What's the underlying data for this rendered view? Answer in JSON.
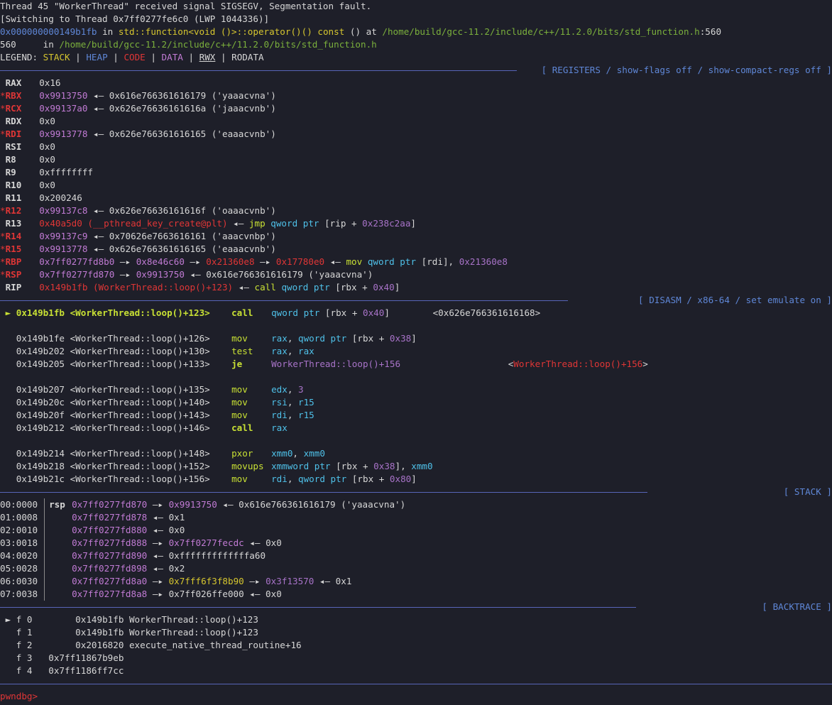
{
  "header": {
    "signal_line": "Thread 45 \"WorkerThread\" received signal SIGSEGV, Segmentation fault.",
    "switch_line": "[Switching to Thread 0x7ff0277fe6c0 (LWP 1044336)]",
    "frame_addr": "0x000000000149b1fb",
    "frame_in": " in ",
    "frame_func": "std::function<void ()>::operator()() const",
    "frame_args": " () at ",
    "frame_path": "/home/build/gcc-11.2/include/c++/11.2.0/bits/std_function.h",
    "frame_line": ":560",
    "source_lineno": "560",
    "source_in": "     in ",
    "source_path": "/home/build/gcc-11.2/include/c++/11.2.0/bits/std_function.h",
    "legend_label": "LEGEND: ",
    "legend": {
      "stack": "STACK",
      "heap": "HEAP",
      "code": "CODE",
      "data": "DATA",
      "rwx": "RWX",
      "rodata": "RODATA",
      "sep": " | "
    }
  },
  "sections": {
    "registers": "[ REGISTERS / show-flags off / show-compact-regs off ]",
    "disasm": "[ DISASM / x86-64 / set emulate on ]",
    "stack": "[ STACK ]",
    "backtrace": "[ BACKTRACE ]"
  },
  "registers": [
    {
      "star": " ",
      "name": "RAX",
      "parts": [
        [
          "white",
          "0x16"
        ]
      ]
    },
    {
      "star": "*",
      "name": "RBX",
      "parts": [
        [
          "purple",
          "0x9913750"
        ],
        [
          "white",
          " ◂— 0x616e766361616179 ('yaaacvna')"
        ]
      ]
    },
    {
      "star": "*",
      "name": "RCX",
      "parts": [
        [
          "purple",
          "0x99137a0"
        ],
        [
          "white",
          " ◂— 0x626e76636161616a ('jaaacvnb')"
        ]
      ]
    },
    {
      "star": " ",
      "name": "RDX",
      "parts": [
        [
          "white",
          "0x0"
        ]
      ]
    },
    {
      "star": "*",
      "name": "RDI",
      "parts": [
        [
          "purple",
          "0x9913778"
        ],
        [
          "white",
          " ◂— 0x626e766361616165 ('eaaacvnb')"
        ]
      ]
    },
    {
      "star": " ",
      "name": "RSI",
      "parts": [
        [
          "white",
          "0x0"
        ]
      ]
    },
    {
      "star": " ",
      "name": "R8",
      "parts": [
        [
          "white",
          "0x0"
        ]
      ]
    },
    {
      "star": " ",
      "name": "R9",
      "parts": [
        [
          "white",
          "0xffffffff"
        ]
      ]
    },
    {
      "star": " ",
      "name": "R10",
      "parts": [
        [
          "white",
          "0x0"
        ]
      ]
    },
    {
      "star": " ",
      "name": "R11",
      "parts": [
        [
          "white",
          "0x200246"
        ]
      ]
    },
    {
      "star": "*",
      "name": "R12",
      "parts": [
        [
          "purple",
          "0x99137c8"
        ],
        [
          "white",
          " ◂— 0x626e76636161616f ('oaaacvnb')"
        ]
      ]
    },
    {
      "star": " ",
      "name": "R13",
      "parts": [
        [
          "red",
          "0x40a5d0 (__pthread_key_create@plt)"
        ],
        [
          "white",
          " ◂— "
        ],
        [
          "lime",
          "jmp"
        ],
        [
          "white",
          " "
        ],
        [
          "cyan",
          "qword ptr"
        ],
        [
          "white",
          " [rip + "
        ],
        [
          "mag",
          "0x238c2aa"
        ],
        [
          "white",
          "]"
        ]
      ]
    },
    {
      "star": "*",
      "name": "R14",
      "parts": [
        [
          "purple",
          "0x99137c9"
        ],
        [
          "white",
          " ◂— 0x70626e7663616161 ('aaacvnbp')"
        ]
      ]
    },
    {
      "star": "*",
      "name": "R15",
      "parts": [
        [
          "purple",
          "0x9913778"
        ],
        [
          "white",
          " ◂— 0x626e766361616165 ('eaaacvnb')"
        ]
      ]
    },
    {
      "star": "*",
      "name": "RBP",
      "parts": [
        [
          "purple",
          "0x7ff0277fd8b0"
        ],
        [
          "white",
          " —▸ "
        ],
        [
          "purple",
          "0x8e46c60"
        ],
        [
          "white",
          " —▸ "
        ],
        [
          "red",
          "0x21360e8"
        ],
        [
          "white",
          " —▸ "
        ],
        [
          "red",
          "0x17780e0"
        ],
        [
          "white",
          " ◂— "
        ],
        [
          "lime",
          "mov"
        ],
        [
          "white",
          " "
        ],
        [
          "cyan",
          "qword ptr"
        ],
        [
          "white",
          " [rdi], "
        ],
        [
          "mag",
          "0x21360e8"
        ]
      ]
    },
    {
      "star": "*",
      "name": "RSP",
      "parts": [
        [
          "purple",
          "0x7ff0277fd870"
        ],
        [
          "white",
          " —▸ "
        ],
        [
          "purple",
          "0x9913750"
        ],
        [
          "white",
          " ◂— 0x616e766361616179 ('yaaacvna')"
        ]
      ]
    },
    {
      "star": " ",
      "name": "RIP",
      "parts": [
        [
          "red",
          "0x149b1fb (WorkerThread::loop()+123)"
        ],
        [
          "white",
          " ◂— "
        ],
        [
          "lime",
          "call"
        ],
        [
          "white",
          " "
        ],
        [
          "cyan",
          "qword ptr"
        ],
        [
          "white",
          " [rbx + "
        ],
        [
          "mag",
          "0x40"
        ],
        [
          "white",
          "]"
        ]
      ]
    }
  ],
  "disasm": [
    {
      "cur": true,
      "addr": "0x149b1fb",
      "sym": "<WorkerThread::loop()+123>",
      "op": "call",
      "parts": [
        [
          "cyan",
          "qword ptr"
        ],
        [
          "white",
          " [rbx + "
        ],
        [
          "mag",
          "0x40"
        ],
        [
          "white",
          "]        <0x626e766361616168>"
        ]
      ]
    },
    {
      "blank": true
    },
    {
      "addr": "0x149b1fe",
      "sym": "<WorkerThread::loop()+126>",
      "op": "mov",
      "parts": [
        [
          "cyan",
          "rax"
        ],
        [
          "white",
          ", "
        ],
        [
          "cyan",
          "qword ptr"
        ],
        [
          "white",
          " [rbx + "
        ],
        [
          "mag",
          "0x38"
        ],
        [
          "white",
          "]"
        ]
      ]
    },
    {
      "addr": "0x149b202",
      "sym": "<WorkerThread::loop()+130>",
      "op": "test",
      "parts": [
        [
          "cyan",
          "rax"
        ],
        [
          "white",
          ", "
        ],
        [
          "cyan",
          "rax"
        ]
      ]
    },
    {
      "addr": "0x149b205",
      "sym": "<WorkerThread::loop()+133>",
      "op": "je",
      "boldop": true,
      "parts": [
        [
          "mag",
          "WorkerThread::loop()+156"
        ],
        [
          "white",
          "                    <"
        ],
        [
          "red",
          "WorkerThread::loop()+156"
        ],
        [
          "white",
          ">"
        ]
      ]
    },
    {
      "blank": true
    },
    {
      "addr": "0x149b207",
      "sym": "<WorkerThread::loop()+135>",
      "op": "mov",
      "parts": [
        [
          "cyan",
          "edx"
        ],
        [
          "white",
          ", "
        ],
        [
          "mag",
          "3"
        ]
      ]
    },
    {
      "addr": "0x149b20c",
      "sym": "<WorkerThread::loop()+140>",
      "op": "mov",
      "parts": [
        [
          "cyan",
          "rsi"
        ],
        [
          "white",
          ", "
        ],
        [
          "cyan",
          "r15"
        ]
      ]
    },
    {
      "addr": "0x149b20f",
      "sym": "<WorkerThread::loop()+143>",
      "op": "mov",
      "parts": [
        [
          "cyan",
          "rdi"
        ],
        [
          "white",
          ", "
        ],
        [
          "cyan",
          "r15"
        ]
      ]
    },
    {
      "addr": "0x149b212",
      "sym": "<WorkerThread::loop()+146>",
      "op": "call",
      "boldop": true,
      "parts": [
        [
          "cyan",
          "rax"
        ]
      ]
    },
    {
      "blank": true
    },
    {
      "addr": "0x149b214",
      "sym": "<WorkerThread::loop()+148>",
      "op": "pxor",
      "parts": [
        [
          "cyan",
          "xmm0"
        ],
        [
          "white",
          ", "
        ],
        [
          "cyan",
          "xmm0"
        ]
      ]
    },
    {
      "addr": "0x149b218",
      "sym": "<WorkerThread::loop()+152>",
      "op": "movups",
      "parts": [
        [
          "cyan",
          "xmmword ptr"
        ],
        [
          "white",
          " [rbx + "
        ],
        [
          "mag",
          "0x38"
        ],
        [
          "white",
          "], "
        ],
        [
          "cyan",
          "xmm0"
        ]
      ]
    },
    {
      "addr": "0x149b21c",
      "sym": "<WorkerThread::loop()+156>",
      "op": "mov",
      "parts": [
        [
          "cyan",
          "rdi"
        ],
        [
          "white",
          ", "
        ],
        [
          "cyan",
          "qword ptr"
        ],
        [
          "white",
          " [rbx + "
        ],
        [
          "mag",
          "0x80"
        ],
        [
          "white",
          "]"
        ]
      ]
    }
  ],
  "stack": [
    {
      "off": "00:0000",
      "reg": "rsp",
      "parts": [
        [
          "purple",
          "0x7ff0277fd870"
        ],
        [
          "white",
          " —▸ "
        ],
        [
          "purple",
          "0x9913750"
        ],
        [
          "white",
          " ◂— 0x616e766361616179 ('yaaacvna')"
        ]
      ]
    },
    {
      "off": "01:0008",
      "reg": "",
      "parts": [
        [
          "purple",
          "0x7ff0277fd878"
        ],
        [
          "white",
          " ◂— 0x1"
        ]
      ]
    },
    {
      "off": "02:0010",
      "reg": "",
      "parts": [
        [
          "purple",
          "0x7ff0277fd880"
        ],
        [
          "white",
          " ◂— 0x0"
        ]
      ]
    },
    {
      "off": "03:0018",
      "reg": "",
      "parts": [
        [
          "purple",
          "0x7ff0277fd888"
        ],
        [
          "white",
          " —▸ "
        ],
        [
          "purple",
          "0x7ff0277fecdc"
        ],
        [
          "white",
          " ◂— 0x0"
        ]
      ]
    },
    {
      "off": "04:0020",
      "reg": "",
      "parts": [
        [
          "purple",
          "0x7ff0277fd890"
        ],
        [
          "white",
          " ◂— 0xfffffffffffffa60"
        ]
      ]
    },
    {
      "off": "05:0028",
      "reg": "",
      "parts": [
        [
          "purple",
          "0x7ff0277fd898"
        ],
        [
          "white",
          " ◂— 0x2"
        ]
      ]
    },
    {
      "off": "06:0030",
      "reg": "",
      "parts": [
        [
          "purple",
          "0x7ff0277fd8a0"
        ],
        [
          "white",
          " —▸ "
        ],
        [
          "yellow",
          "0x7fff6f3f8b90"
        ],
        [
          "white",
          " —▸ "
        ],
        [
          "mag",
          "0x3f13570"
        ],
        [
          "white",
          " ◂— 0x1"
        ]
      ]
    },
    {
      "off": "07:0038",
      "reg": "",
      "parts": [
        [
          "purple",
          "0x7ff0277fd8a8"
        ],
        [
          "white",
          " —▸ 0x7ff026ffe000 ◂— 0x0"
        ]
      ]
    }
  ],
  "backtrace": [
    {
      "mark": "►",
      "text": " f 0        0x149b1fb WorkerThread::loop()+123"
    },
    {
      "mark": " ",
      "text": " f 1        0x149b1fb WorkerThread::loop()+123"
    },
    {
      "mark": " ",
      "text": " f 2        0x2016820 execute_native_thread_routine+16"
    },
    {
      "mark": " ",
      "text": " f 3   0x7ff11867b9eb"
    },
    {
      "mark": " ",
      "text": " f 4   0x7ff1186ff7cc"
    }
  ],
  "prompt": "pwndbg>"
}
